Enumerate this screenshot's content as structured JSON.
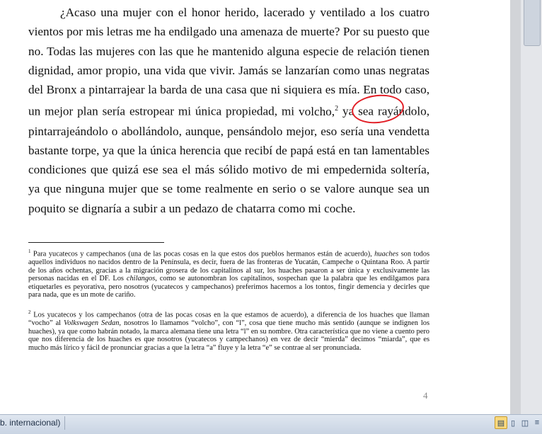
{
  "document": {
    "body_lines": [
      "¿Acaso una mujer con el honor herido, lacerado y ventilado a los cuatro",
      "vientos por mis letras me ha endilgado una amenaza de muerte? Por su puesto",
      "que no. Todas las mujeres con las que he mantenido alguna especie de relación",
      "tienen dignidad, amor propio, una vida que vivir. Jamás se lanzarían como unas",
      "negratas del Bronx a pintarrajear la barda de una casa que ni siquiera es mía. En"
    ],
    "line6_before": "todo caso, un mejor plan sería estropear mi única propiedad, mi ",
    "line6_circled": "volcho,",
    "line6_sup": "2",
    "line6_after": " ya sea",
    "body_rest": [
      "rayándolo, pintarrajeándolo o abollándolo, aunque, pensándolo mejor, eso sería",
      "una vendetta bastante torpe, ya que la única herencia que recibí de papá está en",
      "tan lamentables condiciones que quizá ese sea el más sólido motivo de mi",
      "empedernida soltería, ya que ninguna mujer que se tome realmente en serio o se",
      "valore aunque sea un poquito se dignaría a subir a un pedazo de chatarra como",
      "mi coche."
    ],
    "footnote1": {
      "marker": "1",
      "part1": " Para yucatecos y campechanos (una de las pocas cosas en la que estos dos pueblos hermanos están de acuerdo), ",
      "italic1": "huaches",
      "part2": " son todos aquellos individuos no nacidos dentro de la Península, es decir, fuera de las fronteras de Yucatán, Campeche o Quintana Roo. A partir de los años ochentas, gracias a la migración grosera de los capitalinos al sur, los huaches pasaron a ser única y exclusivamente las personas nacidas en el DF. Los ",
      "italic2": "chilangos",
      "part3": ", como se autonombran los capitalinos, sospechan que la palabra que les endilgamos para etiquetarles es peyorativa, pero nosotros (yucatecos y campechanos) preferimos hacernos a los tontos, fingir demencia y decirles que para nada, que es un mote de cariño."
    },
    "footnote2": {
      "marker": "2",
      "part1": " Los yucatecos y los campechanos (otra de las pocas cosas en la que estamos de acuerdo), a diferencia de los huaches que llaman “vocho” al ",
      "italic1": "Volkswagen Sedan",
      "part2": ", nosotros lo llamamos “volcho”, con “l”, cosa que tiene mucho más sentido (aunque se indignen los huaches), ya que como habrán notado, la marca alemana tiene una letra “l” en su nombre. Otra característica que no viene a cuento pero que nos diferencia de los huaches es que nosotros (yucatecos y campechanos) en vez de decir “mierda” decimos “miarda”, que es mucho más lírico y fácil de pronunciar gracias a que la letra “a” fluye y la letra “e” se contrae al ser pronunciada."
    },
    "page_number": "4"
  },
  "status_bar": {
    "language": "b. internacional)",
    "views": [
      {
        "name": "print-layout",
        "icon": "print-layout-icon",
        "glyph": "▤",
        "active": true
      },
      {
        "name": "full-screen-reading",
        "icon": "full-screen-reading-icon",
        "glyph": "▯",
        "active": false
      },
      {
        "name": "web-layout",
        "icon": "web-layout-icon",
        "glyph": "◫",
        "active": false
      },
      {
        "name": "outline",
        "icon": "outline-icon",
        "glyph": "≡",
        "active": false
      }
    ]
  },
  "colors": {
    "annotation_circle": "#e21e26",
    "status_bar": "#dfe6f0",
    "active_view": "#f9d97d"
  }
}
